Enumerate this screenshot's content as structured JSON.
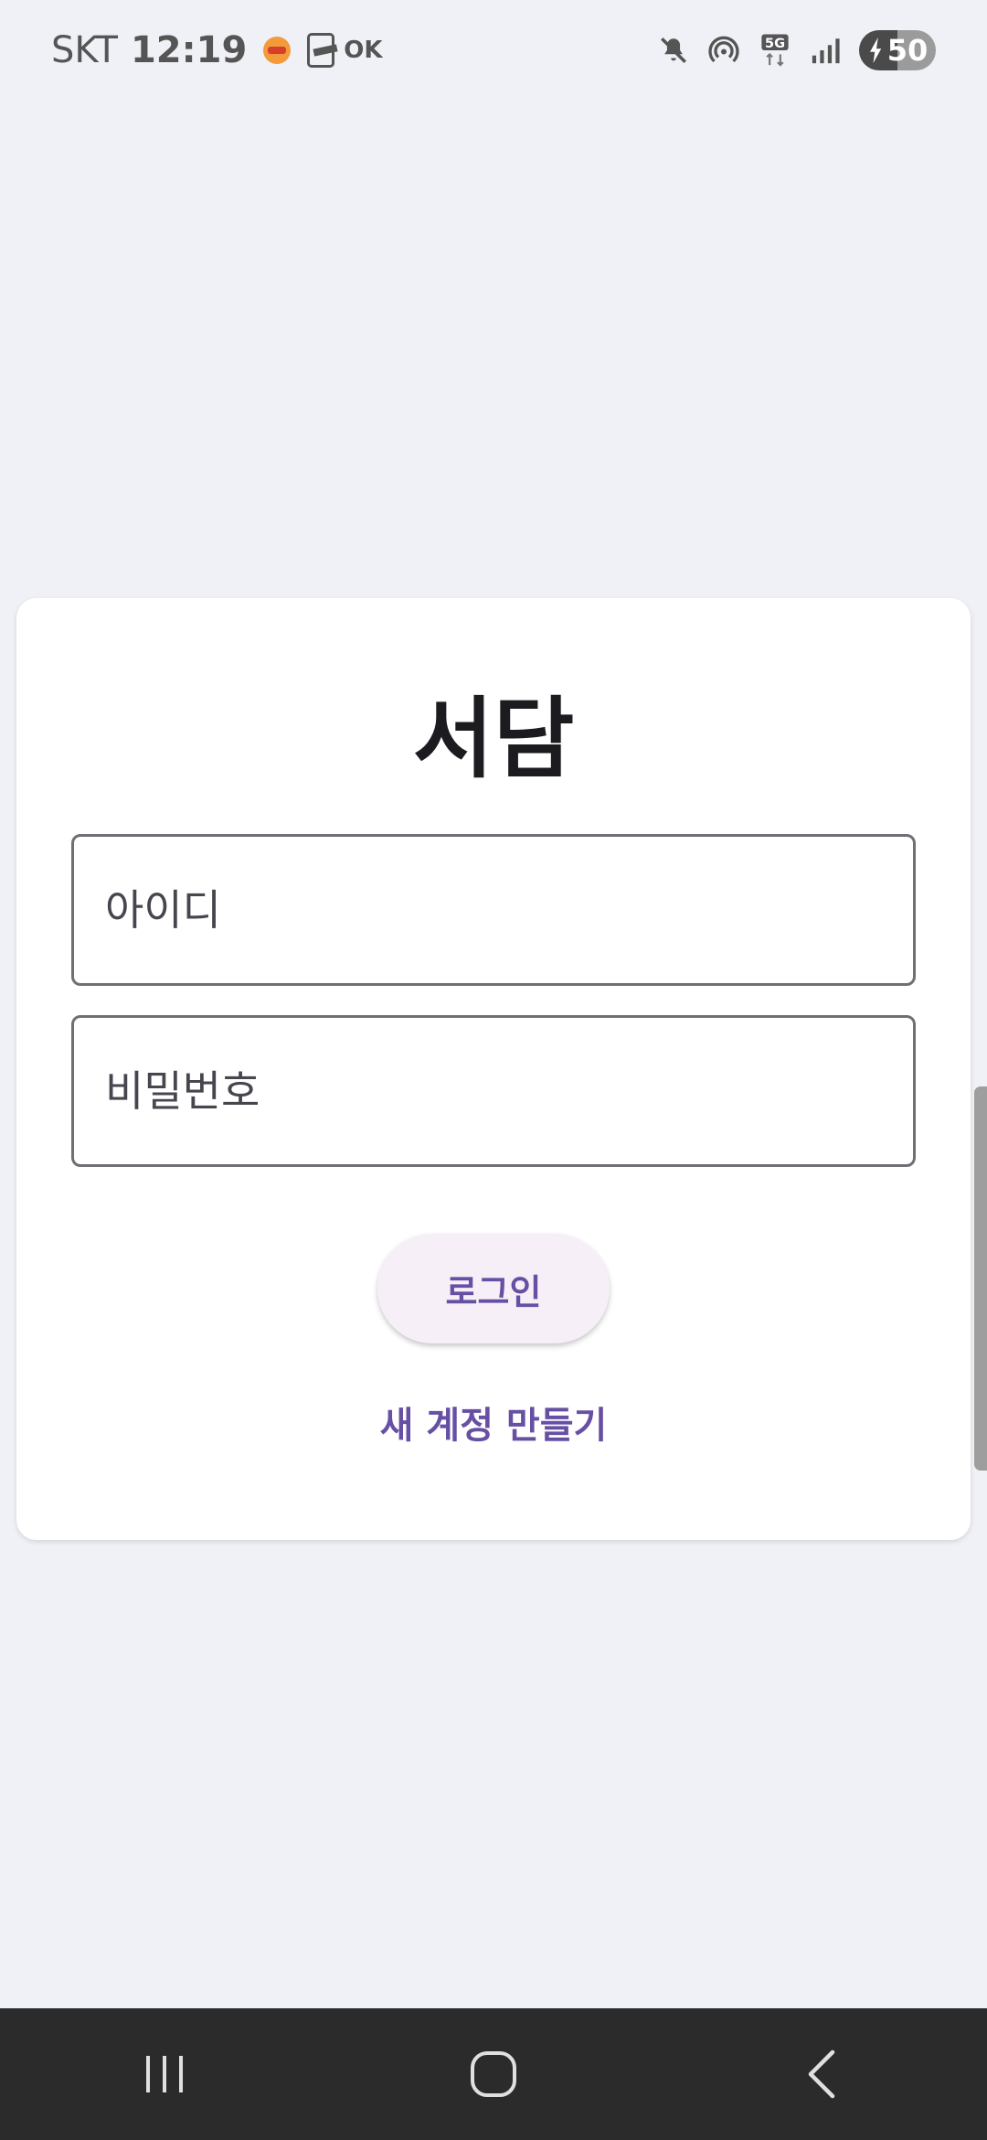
{
  "status_bar": {
    "carrier": "SKT",
    "time": "12:19",
    "ok_label": "OK",
    "network": "5G",
    "battery": "50",
    "notification_icons": [
      "burger-king-icon",
      "payco-icon",
      "ok-cashbag-icon"
    ],
    "system_icons": [
      "mute-icon",
      "hotspot-icon",
      "5g-icon",
      "signal-icon",
      "battery-charging-icon"
    ]
  },
  "login": {
    "title": "서담",
    "username_placeholder": "아이디",
    "password_placeholder": "비밀번호",
    "login_label": "로그인",
    "signup_label": "새 계정 만들기"
  },
  "colors": {
    "background": "#f0f1f6",
    "accent": "#6750a4",
    "button_bg": "#f6eff7"
  },
  "nav_bar": {
    "buttons": [
      "recents-icon",
      "home-icon",
      "back-icon"
    ]
  }
}
